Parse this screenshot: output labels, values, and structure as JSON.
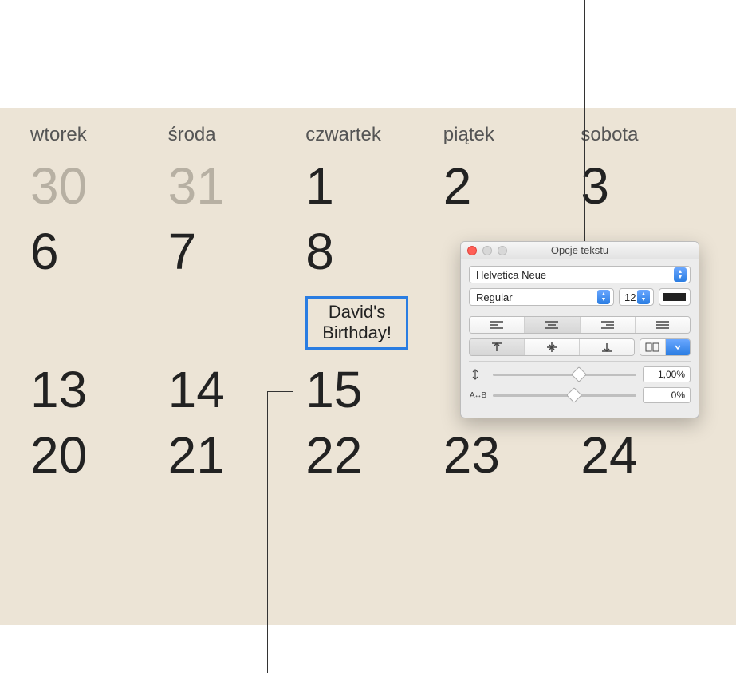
{
  "calendar": {
    "day_names": [
      "wtorek",
      "środa",
      "czwartek",
      "piątek",
      "sobota"
    ],
    "rows": [
      [
        {
          "n": "30",
          "dim": true
        },
        {
          "n": "31",
          "dim": true
        },
        {
          "n": "1"
        },
        {
          "n": "2"
        },
        {
          "n": "3"
        }
      ],
      [
        {
          "n": "6"
        },
        {
          "n": "7"
        },
        {
          "n": "8"
        },
        {
          "n": ""
        },
        {
          "n": ""
        }
      ],
      [
        {
          "event": "David's\nBirthday!"
        },
        {
          "n": ""
        },
        {
          "n": ""
        },
        {
          "n": ""
        },
        {
          "n": ""
        }
      ],
      [
        {
          "n": "13"
        },
        {
          "n": "14"
        },
        {
          "n": "15"
        },
        {
          "n": ""
        },
        {
          "n": ""
        }
      ],
      [
        {
          "n": "20"
        },
        {
          "n": "21"
        },
        {
          "n": "22"
        },
        {
          "n": "23"
        },
        {
          "n": "24"
        }
      ]
    ]
  },
  "panel": {
    "title": "Opcje tekstu",
    "font_family": "Helvetica Neue",
    "font_style": "Regular",
    "font_size": "12",
    "line_spacing_value": "1,00%",
    "char_spacing_value": "0%"
  }
}
